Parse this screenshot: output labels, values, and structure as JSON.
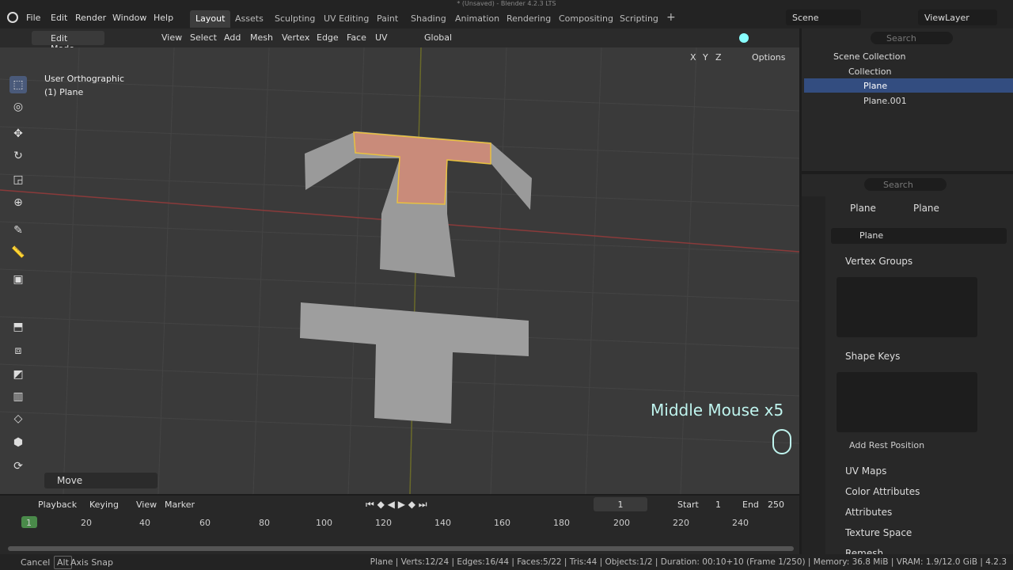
{
  "window": {
    "title": "* (Unsaved) - Blender 4.2.3 LTS"
  },
  "menu": [
    "File",
    "Edit",
    "Render",
    "Window",
    "Help"
  ],
  "workspaces": [
    "Layout",
    "Assets",
    "Sculpting",
    "UV Editing",
    "Paint",
    "Shading",
    "Animation",
    "Rendering",
    "Compositing",
    "Scripting"
  ],
  "scene": "Scene",
  "view_layer": "ViewLayer",
  "header": {
    "mode": "Edit Mode",
    "items": [
      "View",
      "Select",
      "Add",
      "Mesh",
      "Vertex",
      "Edge",
      "Face",
      "UV"
    ],
    "transform": "Global",
    "options": "Options",
    "axes": [
      "X",
      "Y",
      "Z"
    ]
  },
  "viewport": {
    "view_name": "User Orthographic",
    "object": "(1) Plane",
    "overlay_text": "Middle Mouse x5",
    "last_op": "Move"
  },
  "outliner": {
    "search": "Search",
    "root": "Scene Collection",
    "collection": "Collection",
    "objects": [
      "Plane",
      "Plane.001"
    ]
  },
  "properties": {
    "search": "Search",
    "breadcrumb": [
      "Plane",
      "Plane"
    ],
    "data_name": "Plane",
    "panels": [
      "Vertex Groups",
      "Shape Keys",
      "UV Maps",
      "Color Attributes",
      "Attributes",
      "Texture Space",
      "Remesh"
    ],
    "add_rest": "Add Rest Position"
  },
  "timeline": {
    "menus": [
      "Playback",
      "Keying",
      "View",
      "Marker"
    ],
    "frame": "1",
    "start_label": "Start",
    "start": "1",
    "end_label": "End",
    "end": "250",
    "ticks": [
      "1",
      "20",
      "40",
      "60",
      "80",
      "100",
      "120",
      "140",
      "160",
      "180",
      "200",
      "220",
      "240"
    ]
  },
  "status": {
    "cancel": "Cancel",
    "alt": "Alt",
    "axis_snap": "Axis Snap",
    "stats": "Plane | Verts:12/24 | Edges:16/44 | Faces:5/22 | Tris:44 | Objects:1/2 | Duration: 00:10+10 (Frame 1/250) | Memory: 36.8 MiB | VRAM: 1.9/12.0 GiB | 4.2.3"
  }
}
